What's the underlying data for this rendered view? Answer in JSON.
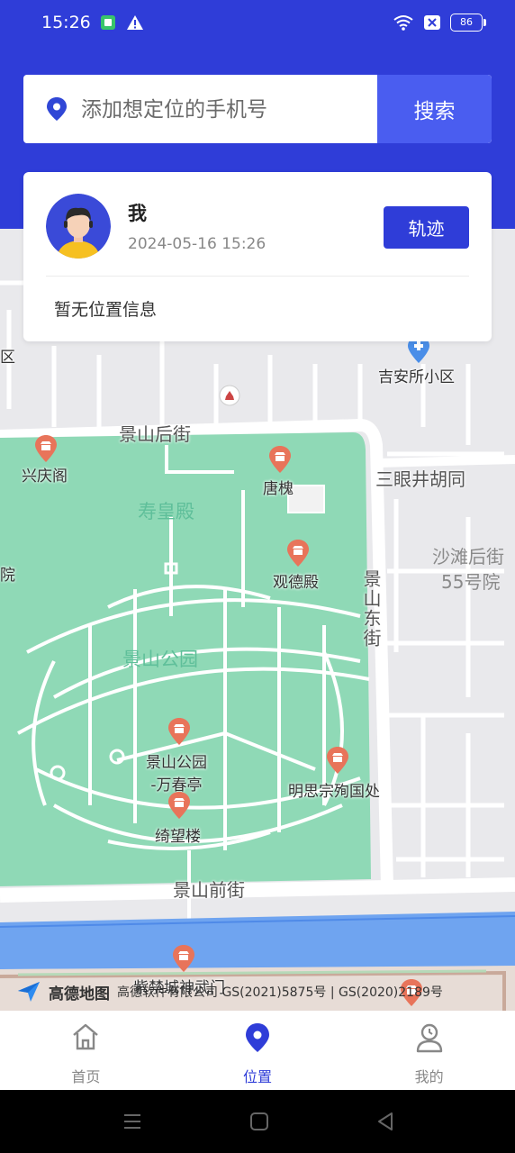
{
  "status_bar": {
    "time": "15:26",
    "battery": "86",
    "left_icons": [
      "notification-app-icon",
      "warning-icon"
    ],
    "right_icons": [
      "wifi-icon",
      "no-sim-icon",
      "battery-icon"
    ]
  },
  "search": {
    "placeholder": "添加想定位的手机号",
    "button_label": "搜索"
  },
  "user_card": {
    "name": "我",
    "timestamp": "2024-05-16 15:26",
    "track_button_label": "轨迹",
    "location_status": "暂无位置信息"
  },
  "map": {
    "labels": {
      "jingshan_houjie": "景山后街",
      "jian_suo_xiaoqu": "吉安所小区",
      "xingqing_ge": "兴庆阁",
      "tang_huai": "唐槐",
      "san_yanjing_hutong": "三眼井胡同",
      "shouhuang_dian": "寿皇殿",
      "guande_dian": "观德殿",
      "shatan_hou_jie": "沙滩后街",
      "no_55_courtyard": "55号院",
      "jingshan_dongjie": "景山东街",
      "jingshan_park": "景山公园",
      "wanchun_ting": "景山公园\n-万春亭",
      "mingsi_zong": "明思宗殉国处",
      "qiwang_lou": "绮望楼",
      "jingshan_qianjie": "景山前街",
      "shenwu_men": "紫禁城神武门",
      "edge_yuan": "院",
      "edge_qu": "区"
    },
    "park_color": "#8fd9b6",
    "road_color": "#ffffff",
    "water_color": "#6fa4f0"
  },
  "attribution": {
    "logo": "高德地图",
    "text": "高德软件有限公司  GS(2021)5875号 | GS(2020)2189号"
  },
  "bottom_nav": {
    "items": [
      {
        "label": "首页",
        "icon": "home-icon"
      },
      {
        "label": "位置",
        "icon": "location-pin-icon"
      },
      {
        "label": "我的",
        "icon": "profile-icon"
      }
    ],
    "active_index": 1
  },
  "colors": {
    "brand_blue": "#2f3dd8",
    "search_button": "#4a5df0"
  }
}
